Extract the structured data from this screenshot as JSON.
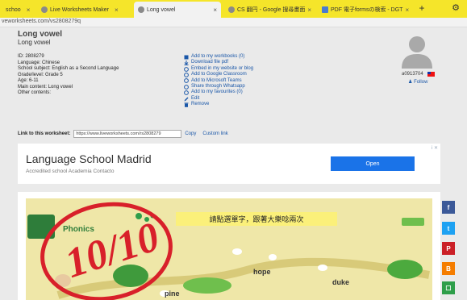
{
  "browser": {
    "tabs": [
      {
        "label": "schoo",
        "active": false
      },
      {
        "label": "Live Worksheets Maker",
        "active": false
      },
      {
        "label": "Long vowel",
        "active": true
      },
      {
        "label": "CS 翻円 - Google 搜尋畫面",
        "active": false
      },
      {
        "label": "PDF 電子formsの検索 - DGT",
        "active": false
      }
    ],
    "new_tab": "+",
    "settings": "⚙",
    "url": "veworksheets.com/vs2808279q"
  },
  "worksheet": {
    "title": "Long vowel",
    "subtitle": "Long vowel",
    "meta": [
      "ID: 2808279",
      "Language: Chinese",
      "School subject: English as a Second Language",
      "Grade/level: Grade 5",
      "Age: 6-11",
      "Main content: Long vowel",
      "Other contents:"
    ],
    "actions": [
      {
        "label": "Add to my workbooks (0)",
        "icon": "book-plus-icon"
      },
      {
        "label": "Download file pdf",
        "icon": "download-icon"
      },
      {
        "label": "Embed in my website or blog",
        "icon": "embed-icon"
      },
      {
        "label": "Add to Google Classroom",
        "icon": "classroom-icon"
      },
      {
        "label": "Add to Microsoft Teams",
        "icon": "teams-icon"
      },
      {
        "label": "Share through Whatsapp",
        "icon": "whatsapp-icon"
      },
      {
        "label": "Add to my favourites (0)",
        "icon": "heart-icon"
      },
      {
        "label": "Edit",
        "icon": "edit-icon"
      },
      {
        "label": "Remove",
        "icon": "trash-icon"
      }
    ],
    "user": {
      "name": "a0913704",
      "follow": "Follow"
    },
    "link_label": "Link to this worksheet:",
    "link_value": "https://www.liveworksheets.com/rs2808279",
    "copy_label": "Copy",
    "custom_link_label": "Custom link"
  },
  "ad": {
    "title": "Language School Madrid",
    "subtitle": "Accredited school Academia Contacto",
    "button": "Open",
    "info": "i ✕"
  },
  "preview": {
    "prompt": "請點選單字，跟著大樂唸兩次",
    "words": [
      "hope",
      "duke",
      "pine"
    ],
    "logo": "Phonics",
    "grade_text": "10/10"
  },
  "share": [
    {
      "label": "f",
      "color": "#3b5998"
    },
    {
      "label": "t",
      "color": "#1da1f2"
    },
    {
      "label": "P",
      "color": "#cb2027"
    },
    {
      "label": "B",
      "color": "#f57d00"
    },
    {
      "label": "☐",
      "color": "#2e9e4a"
    }
  ]
}
